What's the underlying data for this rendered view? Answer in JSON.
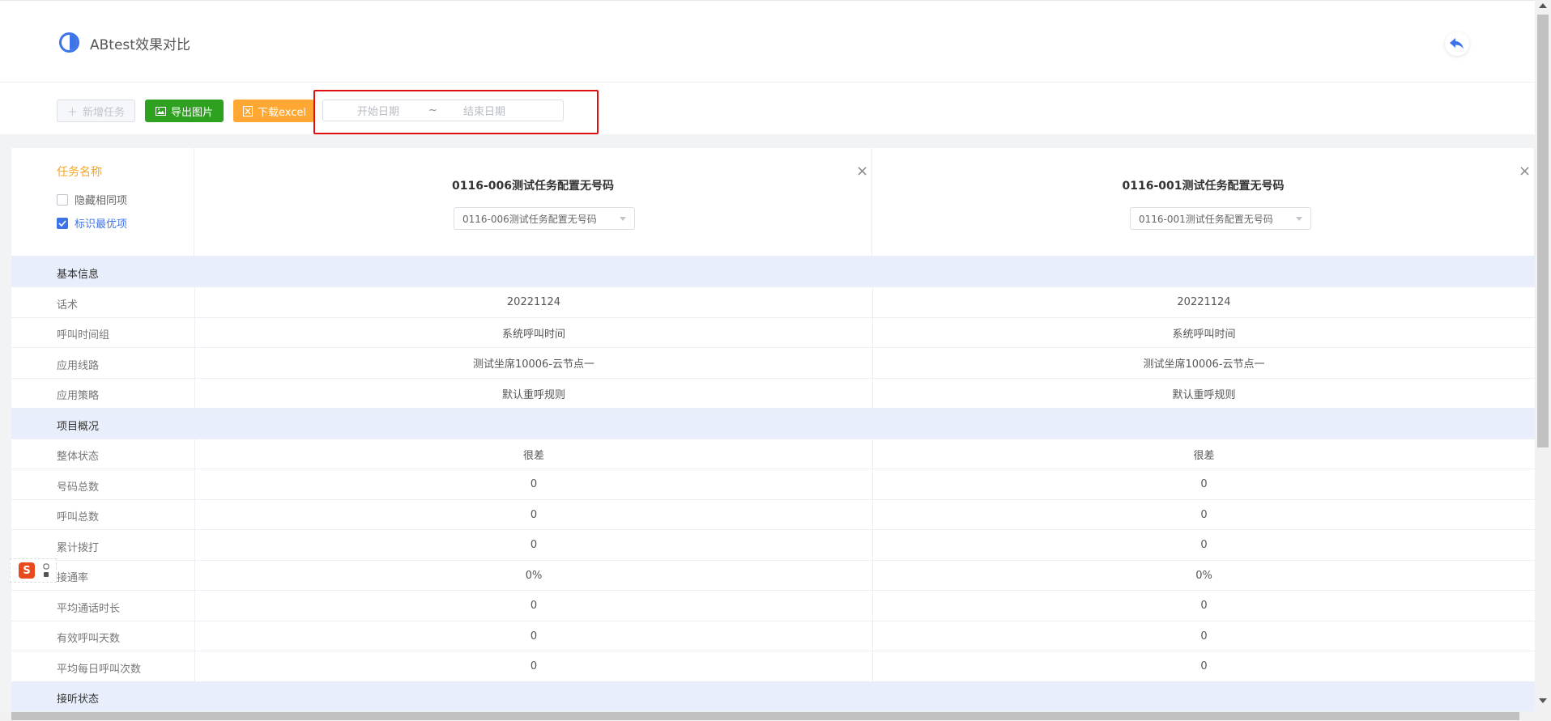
{
  "header": {
    "title": "ABtest效果对比",
    "logo_icon": "half-circle-icon",
    "back_icon": "reply-arrow-icon"
  },
  "toolbar": {
    "new_task_label": "新增任务",
    "export_image_label": "导出图片",
    "download_excel_label": "下载excel",
    "date_start_placeholder": "开始日期",
    "date_separator": "~",
    "date_end_placeholder": "结束日期"
  },
  "colors": {
    "accent": "#3d73e8",
    "export_green": "#2ea121",
    "excel_orange": "#ffa733",
    "task_name_orange": "#f5a623",
    "section_bg": "#e8eefc",
    "highlight_red": "#e01010"
  },
  "compare": {
    "task_name_label": "任务名称",
    "hide_same_label": "隐藏相同项",
    "hide_same_checked": false,
    "mark_best_label": "标识最优项",
    "mark_best_checked": true,
    "tasks": [
      {
        "title": "0116-006测试任务配置无号码",
        "select_value": "0116-006测试任务配置无号码"
      },
      {
        "title": "0116-001测试任务配置无号码",
        "select_value": "0116-001测试任务配置无号码"
      }
    ],
    "rows": [
      {
        "label": "基本信息",
        "section": true,
        "a": "",
        "b": ""
      },
      {
        "label": "话术",
        "section": false,
        "a": "20221124",
        "b": "20221124"
      },
      {
        "label": "呼叫时间组",
        "section": false,
        "a": "系统呼叫时间",
        "b": "系统呼叫时间"
      },
      {
        "label": "应用线路",
        "section": false,
        "a": "测试坐席10006-云节点一",
        "b": "测试坐席10006-云节点一"
      },
      {
        "label": "应用策略",
        "section": false,
        "a": "默认重呼规则",
        "b": "默认重呼规则"
      },
      {
        "label": "项目概况",
        "section": true,
        "a": "",
        "b": ""
      },
      {
        "label": "整体状态",
        "section": false,
        "a": "很差",
        "b": "很差"
      },
      {
        "label": "号码总数",
        "section": false,
        "a": "0",
        "b": "0"
      },
      {
        "label": "呼叫总数",
        "section": false,
        "a": "0",
        "b": "0"
      },
      {
        "label": "累计拨打",
        "section": false,
        "a": "0",
        "b": "0"
      },
      {
        "label": "接通率",
        "section": false,
        "a": "0%",
        "b": "0%"
      },
      {
        "label": "平均通话时长",
        "section": false,
        "a": "0",
        "b": "0"
      },
      {
        "label": "有效呼叫天数",
        "section": false,
        "a": "0",
        "b": "0"
      },
      {
        "label": "平均每日呼叫次数",
        "section": false,
        "a": "0",
        "b": "0"
      },
      {
        "label": "接听状态",
        "section": true,
        "a": "",
        "b": ""
      }
    ]
  },
  "float_widget": {
    "logo_text": "S"
  }
}
